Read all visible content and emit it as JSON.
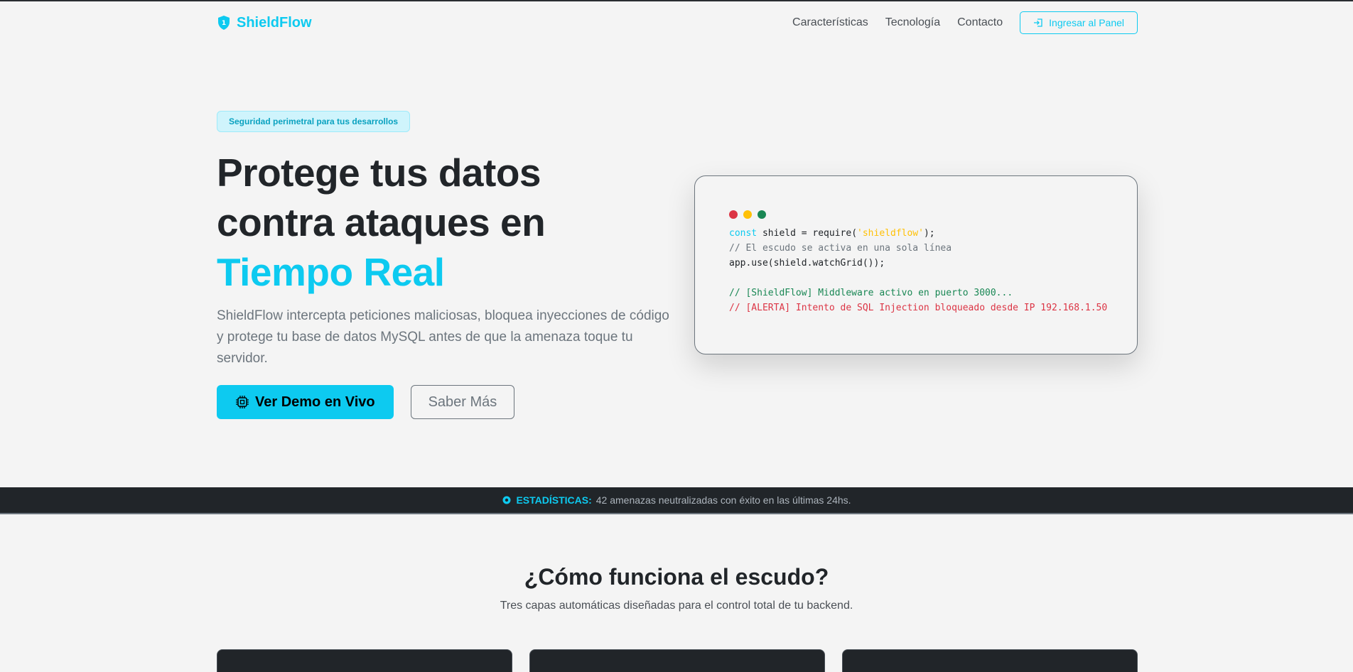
{
  "brand": {
    "name": "ShieldFlow",
    "icon": "shield-icon",
    "color": "#0dcaf0"
  },
  "nav": {
    "links": [
      "Características",
      "Tecnología",
      "Contacto"
    ],
    "panel_button": "Ingresar al Panel"
  },
  "hero": {
    "badge": "Seguridad perimetral para tus desarrollos",
    "title_line1": "Protege tus datos",
    "title_line2": "contra ataques en",
    "title_accent": "Tiempo Real",
    "description": "ShieldFlow intercepta peticiones maliciosas, bloquea inyecciones de código y protege tu base de datos MySQL antes de que la amenaza toque tu servidor.",
    "primary_button": "Ver Demo en Vivo",
    "secondary_button": "Saber Más"
  },
  "code_card": {
    "dot_colors": [
      "#dc3545",
      "#ffc107",
      "#198754"
    ],
    "line1": {
      "kw": "const",
      "plain1": " shield = require(",
      "str": "'shieldflow'",
      "plain2": ");"
    },
    "line2": "// El escudo se activa en una sola línea",
    "line3": "app.use(shield.watchGrid());",
    "line4": "// [ShieldFlow] Middleware activo en puerto 3000...",
    "line5": "// [ALERTA] Intento de SQL Injection bloqueado desde IP 192.168.1.50"
  },
  "stats": {
    "label": "ESTADÍSTICAS:",
    "text": "42 amenazas neutralizadas con éxito en las últimas 24hs."
  },
  "features": {
    "title": "¿Cómo funciona el escudo?",
    "subtitle": "Tres capas automáticas diseñadas para el control total de tu backend."
  }
}
